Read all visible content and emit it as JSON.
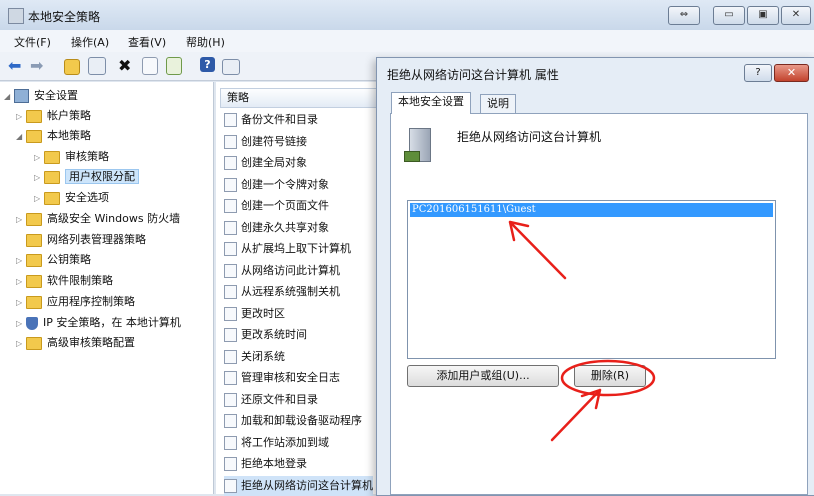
{
  "window": {
    "title": "本地安全策略",
    "buttons": [
      "⇔",
      "▭",
      "▣",
      "✕"
    ]
  },
  "menu": [
    "文件(F)",
    "操作(A)",
    "查看(V)",
    "帮助(H)"
  ],
  "tree": {
    "items": [
      {
        "label": "安全设置",
        "level": 0,
        "arrow": "◢",
        "icon": "security-settings-icon"
      },
      {
        "label": "帐户策略",
        "level": 1,
        "arrow": "▷",
        "icon": "folder-icon"
      },
      {
        "label": "本地策略",
        "level": 1,
        "arrow": "◢",
        "icon": "folder-icon"
      },
      {
        "label": "审核策略",
        "level": 2,
        "arrow": "▷",
        "icon": "folder-icon"
      },
      {
        "label": "用户权限分配",
        "level": 2,
        "arrow": "▷",
        "icon": "folder-icon",
        "selected": true
      },
      {
        "label": "安全选项",
        "level": 2,
        "arrow": "▷",
        "icon": "folder-icon"
      },
      {
        "label": "高级安全 Windows 防火墙",
        "level": 1,
        "arrow": "▷",
        "icon": "folder-icon"
      },
      {
        "label": "网络列表管理器策略",
        "level": 1,
        "arrow": "",
        "icon": "folder-icon"
      },
      {
        "label": "公钥策略",
        "level": 1,
        "arrow": "▷",
        "icon": "folder-icon"
      },
      {
        "label": "软件限制策略",
        "level": 1,
        "arrow": "▷",
        "icon": "folder-icon"
      },
      {
        "label": "应用程序控制策略",
        "level": 1,
        "arrow": "▷",
        "icon": "folder-icon"
      },
      {
        "label": "IP 安全策略，在 本地计算机",
        "level": 1,
        "arrow": "▷",
        "icon": "ip-security-icon"
      },
      {
        "label": "高级审核策略配置",
        "level": 1,
        "arrow": "▷",
        "icon": "folder-icon"
      }
    ]
  },
  "policy_list": {
    "header": "策略",
    "items": [
      "备份文件和目录",
      "创建符号链接",
      "创建全局对象",
      "创建一个令牌对象",
      "创建一个页面文件",
      "创建永久共享对象",
      "从扩展坞上取下计算机",
      "从网络访问此计算机",
      "从远程系统强制关机",
      "更改时区",
      "更改系统时间",
      "关闭系统",
      "管理审核和安全日志",
      "还原文件和目录",
      "加载和卸载设备驱动程序",
      "将工作站添加到域",
      "拒绝本地登录",
      "拒绝从网络访问这台计算机"
    ]
  },
  "dialog": {
    "title": "拒绝从网络访问这台计算机 属性",
    "help_label": "?",
    "close_label": "✕",
    "tabs": [
      "本地安全设置",
      "说明"
    ],
    "policy_name": "拒绝从网络访问这台计算机",
    "entries": [
      "PC201606151611\\Guest"
    ],
    "add_button": "添加用户或组(U)...",
    "remove_button": "删除(R)"
  },
  "colors": {
    "annotation": "#e8201a",
    "selection": "#3399ff"
  }
}
